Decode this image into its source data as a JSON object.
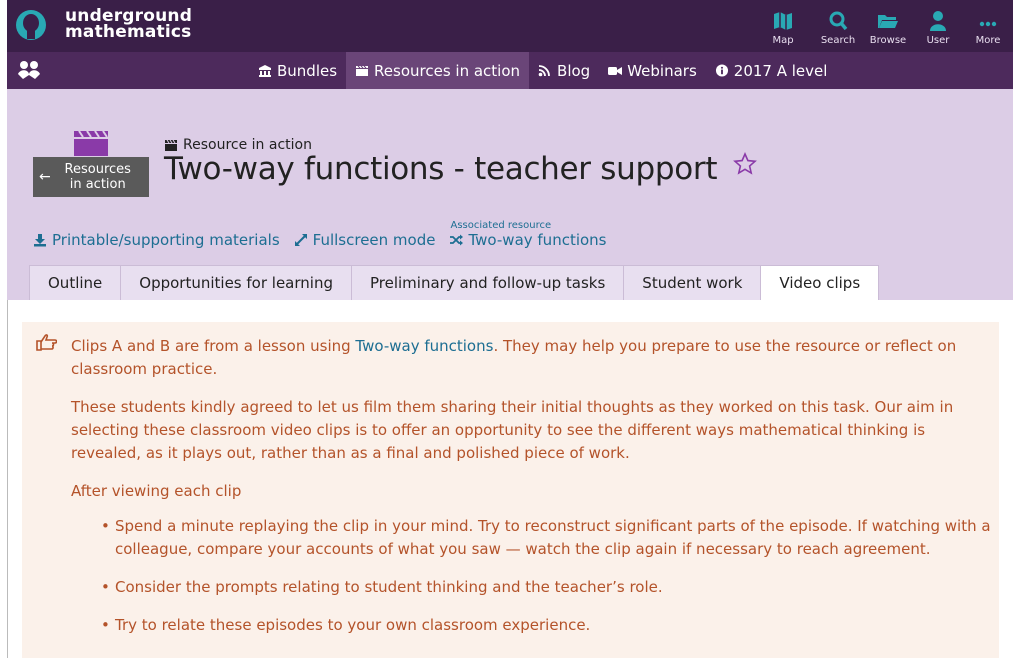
{
  "header": {
    "logo_line1": "underground",
    "logo_line2": "mathematics",
    "nav": [
      {
        "label": "Map",
        "icon": "map-icon"
      },
      {
        "label": "Search",
        "icon": "search-icon"
      },
      {
        "label": "Browse",
        "icon": "folder-icon"
      },
      {
        "label": "User",
        "icon": "user-icon"
      },
      {
        "label": "More",
        "icon": "more-icon"
      }
    ]
  },
  "subnav": {
    "items": [
      {
        "label": "Bundles",
        "icon": "bundles-icon"
      },
      {
        "label": "Resources in action",
        "icon": "clapper-icon"
      },
      {
        "label": "Blog",
        "icon": "rss-icon"
      },
      {
        "label": "Webinars",
        "icon": "video-camera-icon"
      },
      {
        "label": "2017 A level",
        "icon": "info-icon"
      }
    ]
  },
  "banner": {
    "back_label": "Resources in action",
    "kicker": "Resource in action",
    "title": "Two-way functions - teacher support",
    "links": {
      "printable": "Printable/supporting materials",
      "fullscreen": "Fullscreen mode",
      "assoc_label": "Associated resource",
      "assoc_link": "Two-way functions"
    },
    "tabs": [
      "Outline",
      "Opportunities for learning",
      "Preliminary and follow-up tasks",
      "Student work",
      "Video clips"
    ],
    "active_tab": "Video clips"
  },
  "content": {
    "p1_before": "Clips A and B are from a lesson using ",
    "p1_link": "Two-way functions",
    "p1_after": ". They may help you prepare to use the resource or reflect on classroom practice.",
    "p2": "These students kindly agreed to let us film them sharing their initial thoughts as they worked on this task. Our aim in selecting these classroom video clips is to offer an opportunity to see the different ways mathematical thinking is revealed, as it plays out, rather than as a final and polished piece of work.",
    "p3": "After viewing each clip",
    "bullets": [
      "Spend a minute replaying the clip in your mind. Try to reconstruct significant parts of the episode. If watching with a colleague, compare your accounts of what you saw — watch the clip again if necessary to reach agreement.",
      "Consider the prompts relating to student thinking and the teacher’s role.",
      "Try to relate these episodes to your own classroom experience."
    ]
  },
  "colors": {
    "header_bg": "#3a1f48",
    "subnav_bg": "#4d2a5c",
    "banner_bg": "#dccde6",
    "accent": "#29a9b4",
    "link": "#1d6e92",
    "note_text": "#b4532a",
    "note_bg": "#fbf1ea"
  }
}
